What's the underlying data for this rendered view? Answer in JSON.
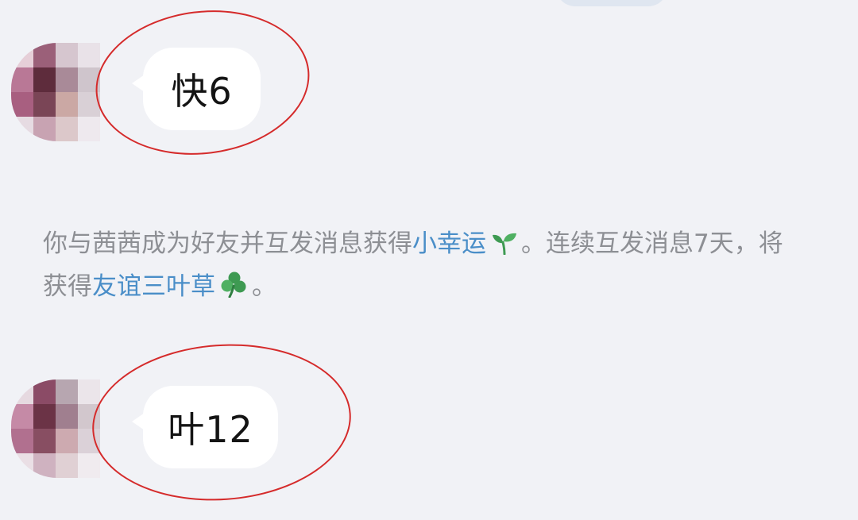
{
  "messages": [
    {
      "text": "快6",
      "avatar_icon": "blurred-avatar-icon",
      "highlight_color": "#d52b2b"
    },
    {
      "text": "叶12",
      "avatar_icon": "blurred-avatar-icon",
      "highlight_color": "#d52b2b"
    }
  ],
  "system_notice": {
    "part1": "你与茜茜成为好友并互发消息获得",
    "link1": "小幸运",
    "icon1": "sprout-icon",
    "part2": "。连续互发消息7天，将获得",
    "link2": "友谊三叶草",
    "icon2": "clover-icon",
    "part3": "。"
  },
  "colors": {
    "background": "#f1f2f6",
    "bubble": "#ffffff",
    "link": "#4a8ec8",
    "notice_text": "#8d8f94",
    "annotation_ring": "#d52b2b",
    "icon_green": "#3e9a52"
  }
}
